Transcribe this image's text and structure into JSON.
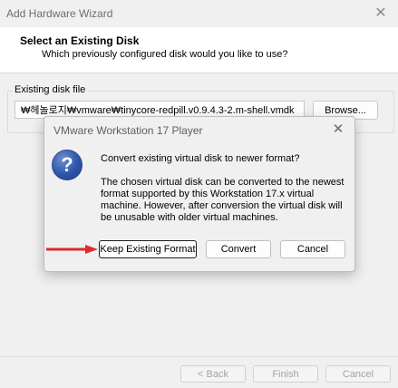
{
  "wizard": {
    "title": "Add Hardware Wizard",
    "header_title": "Select an Existing Disk",
    "header_subtitle": "Which previously configured disk would you like to use?",
    "disk_group_label": "Existing disk file",
    "disk_path": "₩헤놀로지₩vmware₩tinycore-redpill.v0.9.4.3-2.m-shell.vmdk",
    "browse_label": "Browse...",
    "back_label": "< Back",
    "finish_label": "Finish",
    "cancel_label": "Cancel"
  },
  "dialog": {
    "title": "VMware Workstation 17 Player",
    "question": "Convert existing virtual disk to newer format?",
    "body": "The chosen virtual disk can be converted to the newest format supported by this Workstation 17.x virtual machine.  However, after conversion the virtual disk will be unusable with older virtual machines.",
    "keep_label": "Keep Existing Format",
    "convert_label": "Convert",
    "cancel_label": "Cancel",
    "icon": "question-icon"
  },
  "annotation": {
    "color": "#e02a2a"
  }
}
